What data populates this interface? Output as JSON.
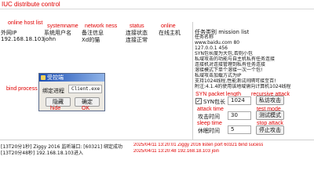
{
  "app": {
    "title": "IUC distribute control"
  },
  "host_list": {
    "annotation": "online host list",
    "annotations": {
      "system": "systemname",
      "network": "network ness",
      "status": "status",
      "online": "online"
    },
    "columns": [
      "外网IP",
      "系统用户名",
      "备注信息",
      "连接状态",
      "在线主机"
    ],
    "rows": [
      {
        "ip": "192.168.18.103",
        "user": "john",
        "note": "Xd的猫",
        "status": "连接正常",
        "online": ""
      }
    ]
  },
  "task_list": {
    "annotation": "mission list",
    "header": "任务类别 mission list",
    "lines": [
      "任务名称",
      "www.baidu.com 80",
      "127.0.0.1 456",
      "SYN包长度为大包,否则小包",
      "私域攻击的功能与自主机私有任务连接",
      "连接机对连接管理到私有任务连接",
      "溶接模式下单个溶接一次一个包!",
      "私域攻击加载方式为IP",
      "支持1024线程,性能测试间隔可接至百!",
      "附注:4.1.4的使用该地域需向计算机1024线程"
    ]
  },
  "annotations": {
    "bind_process": "bind process",
    "hide": "hide",
    "ok": "OK",
    "syn_packet_length": "SYN packet length",
    "recursive_attack": "recursive attack",
    "attack_time": "attack time",
    "test_mode": "test mode",
    "sleep_time": "sleep time",
    "stop_attack": "stop attack"
  },
  "dialog": {
    "title": "受控端",
    "bind_label": "绑定进程",
    "bind_value": "Client.exe",
    "hide_button": "隐藏",
    "ok_button": "确定"
  },
  "attack_panel": {
    "syn_checkbox_label": "SYN包长",
    "syn_checked": true,
    "syn_value": "1024",
    "recursive_button": "私访攻击",
    "attack_time_label": "攻击时间",
    "attack_time_value": "30",
    "test_mode_button": "测试模式",
    "sleep_time_label": "休眠时间",
    "sleep_time_value": "5",
    "stop_button": "停止攻击"
  },
  "log": {
    "lines": [
      "[13T20分1秒]  Ziggy  2016  监听端口: [60321] 绑定成功",
      "[13T20分48秒] 192.168.18.103进入"
    ],
    "translations": [
      "2025/04/11 13:20:01 Ziggy 2016 listen port 60321 bind sucess",
      "2025/04/11 13:20:48  192.168.18.103 join"
    ]
  },
  "colors": {
    "annotation": "#e00000",
    "dialog_title_start": "#1c4fb5",
    "dialog_title_end": "#8fb3e8"
  }
}
